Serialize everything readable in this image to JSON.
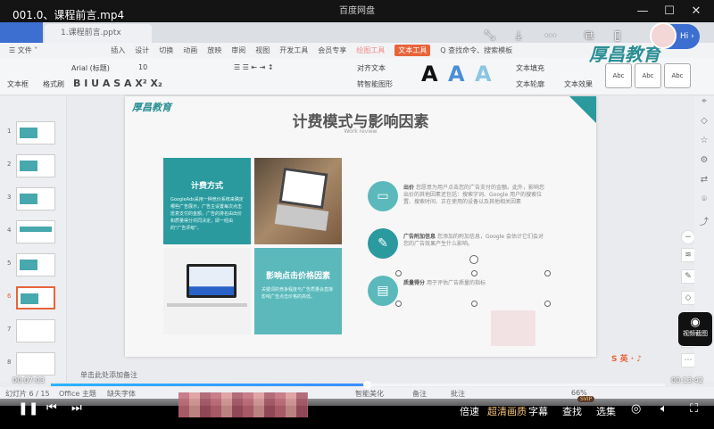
{
  "window": {
    "title": "百度网盘",
    "minimize": "—",
    "maximize": "☐",
    "close": "✕"
  },
  "player": {
    "filename": "001.0、课程前言.mp4",
    "current_time": "00:07:03",
    "total_time": "00:13:42",
    "progress_percent": 51.5,
    "controls": {
      "speed": "倍速",
      "hd": "超清画质",
      "subtitle": "字幕",
      "search": "查找",
      "search_badge": "SVIP",
      "episodes": "选集"
    },
    "screenshot_label": "视频截图",
    "hi_label": "Hi ›"
  },
  "wps": {
    "doc_tab": "1.课程前言.pptx",
    "menu": [
      "☰ 文件 ˅",
      "插入",
      "设计",
      "切换",
      "动画",
      "放映",
      "审阅",
      "视图",
      "开发工具",
      "会员专享",
      "绘图工具",
      "文本工具",
      "Q 查找命令、搜索模板"
    ],
    "ribbon": {
      "textbox": "文本框",
      "format_painter": "格式刷",
      "font": "Arial (标题)",
      "size": "10",
      "align_text": "对齐文本",
      "smart_shape": "转智能图形",
      "text_fill": "文本填充",
      "text_outline": "文本轮廓",
      "text_effect": "文本效果",
      "style_sample": "Abc"
    },
    "slide_numbers": [
      "1",
      "2",
      "3",
      "4",
      "5",
      "6",
      "7",
      "8"
    ],
    "notes_placeholder": "单击此处添加备注",
    "status": {
      "slide": "幻灯片 6 / 15",
      "theme": "Office 主题",
      "missing_font": "缺失字体",
      "beautify": "智能美化",
      "notes": "备注",
      "comment": "批注",
      "zoom": "66%"
    },
    "watermark": "厚昌教育"
  },
  "slide": {
    "logo": "厚昌教育",
    "title": "计费模式与影响因素",
    "subtitle": "Work review",
    "tile1_heading": "计费方式",
    "tile1_text": "GoogleAds采用一种竞价系统来确定哪些广告展示，广告主设置每次点击愿意支付的金额，广告的排名由出价和质量得分共同决定，即一经由的\"广告评级\"。",
    "tile2_heading": "影响点击价格因素",
    "tile2_text": "关键词的竞争程度与广告质量会直接影响广告点击价格的高低。",
    "items": [
      {
        "label": "出价",
        "text": "您愿意为用户点击您的广告支付的金额。此外，影响您出价的其他因素还包括：搜索字词、Google 用户的搜索位置、搜索时间、正在使用的设备以及其他相关因素"
      },
      {
        "label": "广告附加信息",
        "text": "您添加的附加信息，Google 会估计它们会对您的广告效果产生什么影响。"
      },
      {
        "label": "质量得分",
        "text": "用于评估广告质量的指标"
      }
    ]
  }
}
